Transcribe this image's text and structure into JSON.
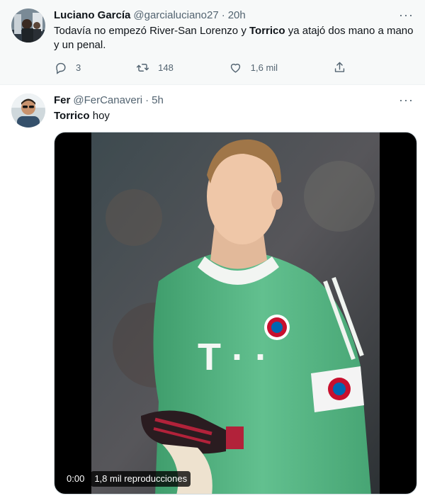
{
  "tweets": [
    {
      "name": "Luciano García",
      "handle": "@garcialuciano27",
      "separator": "·",
      "time": "20h",
      "text_parts": [
        {
          "t": "Todavía no empezó River-San Lorenzo y ",
          "bold": false
        },
        {
          "t": "Torrico",
          "bold": true
        },
        {
          "t": " ya atajó dos mano a mano y un penal.",
          "bold": false
        }
      ],
      "more_label": "···",
      "actions": {
        "reply_count": "3",
        "retweet_count": "148",
        "like_count": "1,6 mil",
        "share_label": ""
      }
    },
    {
      "name": "Fer",
      "handle": "@FerCanaveri",
      "separator": "·",
      "time": "5h",
      "text_parts": [
        {
          "t": "Torrico",
          "bold": true
        },
        {
          "t": " hoy",
          "bold": false
        }
      ],
      "more_label": "···",
      "video": {
        "timestamp": "0:00",
        "views": "1,8 mil reproducciones"
      },
      "jersey_text": "T · ·"
    }
  ],
  "colors": {
    "text_primary": "#0f1419",
    "text_secondary": "#536471",
    "highlight_bg": "#f7f9f9",
    "jersey_green": "#5ab886"
  },
  "icons": [
    "reply-icon",
    "retweet-icon",
    "like-icon",
    "share-icon",
    "more-icon"
  ]
}
